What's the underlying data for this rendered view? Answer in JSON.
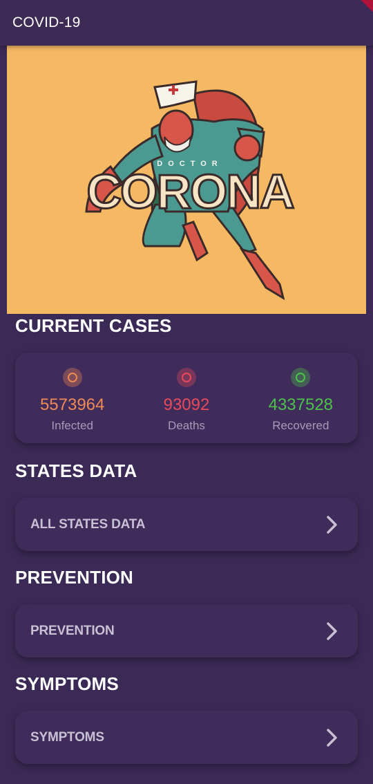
{
  "app_bar": {
    "title": "COVID-19"
  },
  "hero": {
    "small_text": "DOCTOR",
    "big_text": "CORONA",
    "background": "#f5b963"
  },
  "current_cases": {
    "title": "CURRENT CASES",
    "infected": {
      "value": "5573964",
      "label": "Infected",
      "color": "#f08a55"
    },
    "deaths": {
      "value": "93092",
      "label": "Deaths",
      "color": "#e84a5c"
    },
    "recovered": {
      "value": "4337528",
      "label": "Recovered",
      "color": "#4cc24a"
    }
  },
  "states": {
    "title": "STATES DATA",
    "item_label": "ALL STATES DATA"
  },
  "prevention": {
    "title": "PREVENTION",
    "item_label": "PREVENTION"
  },
  "symptoms": {
    "title": "SYMPTOMS",
    "item_label": "SYMPTOMS"
  }
}
